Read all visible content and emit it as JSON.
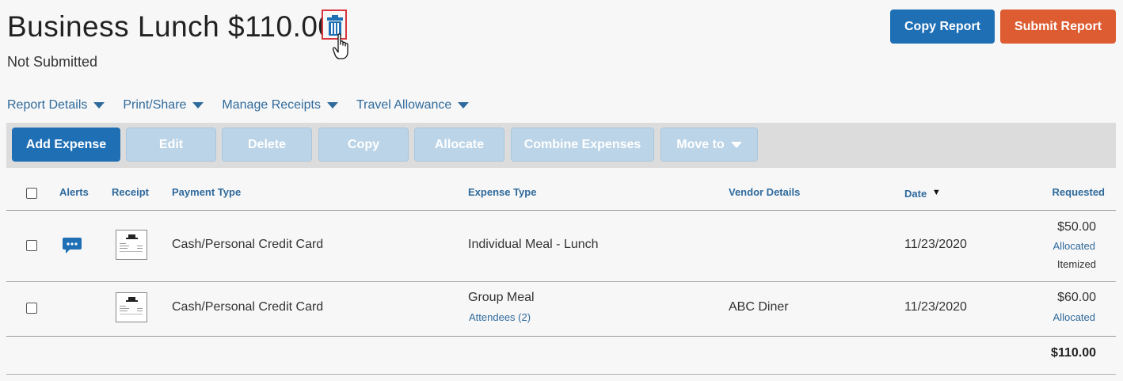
{
  "report": {
    "title": "Business Lunch $110.00",
    "status": "Not Submitted"
  },
  "header_buttons": {
    "copy_report": "Copy Report",
    "submit_report": "Submit Report"
  },
  "menus": [
    {
      "label": "Report Details"
    },
    {
      "label": "Print/Share"
    },
    {
      "label": "Manage Receipts"
    },
    {
      "label": "Travel Allowance"
    }
  ],
  "toolbar": {
    "add_expense": "Add Expense",
    "edit": "Edit",
    "delete": "Delete",
    "copy": "Copy",
    "allocate": "Allocate",
    "combine_expenses": "Combine Expenses",
    "move_to": "Move to"
  },
  "table": {
    "headers": {
      "alerts": "Alerts",
      "receipt": "Receipt",
      "payment_type": "Payment Type",
      "expense_type": "Expense Type",
      "vendor_details": "Vendor Details",
      "date": "Date",
      "requested": "Requested"
    },
    "rows": [
      {
        "payment_type": "Cash/Personal Credit Card",
        "expense_type": "Individual Meal - Lunch",
        "vendor": "",
        "date": "11/23/2020",
        "amount": "$50.00",
        "amount_link": "Allocated",
        "amount_note": "Itemized",
        "alert_icon": "comment-bubble-icon"
      },
      {
        "payment_type": "Cash/Personal Credit Card",
        "expense_type": "Group Meal",
        "expense_link": "Attendees (2)",
        "vendor": "ABC Diner",
        "date": "11/23/2020",
        "amount": "$60.00",
        "amount_link": "Allocated"
      }
    ],
    "total": "$110.00"
  },
  "colors": {
    "primary": "#1f6fb5",
    "submit": "#dd5c32",
    "link": "#2f6a9c",
    "highlight_box": "#d9363e"
  }
}
